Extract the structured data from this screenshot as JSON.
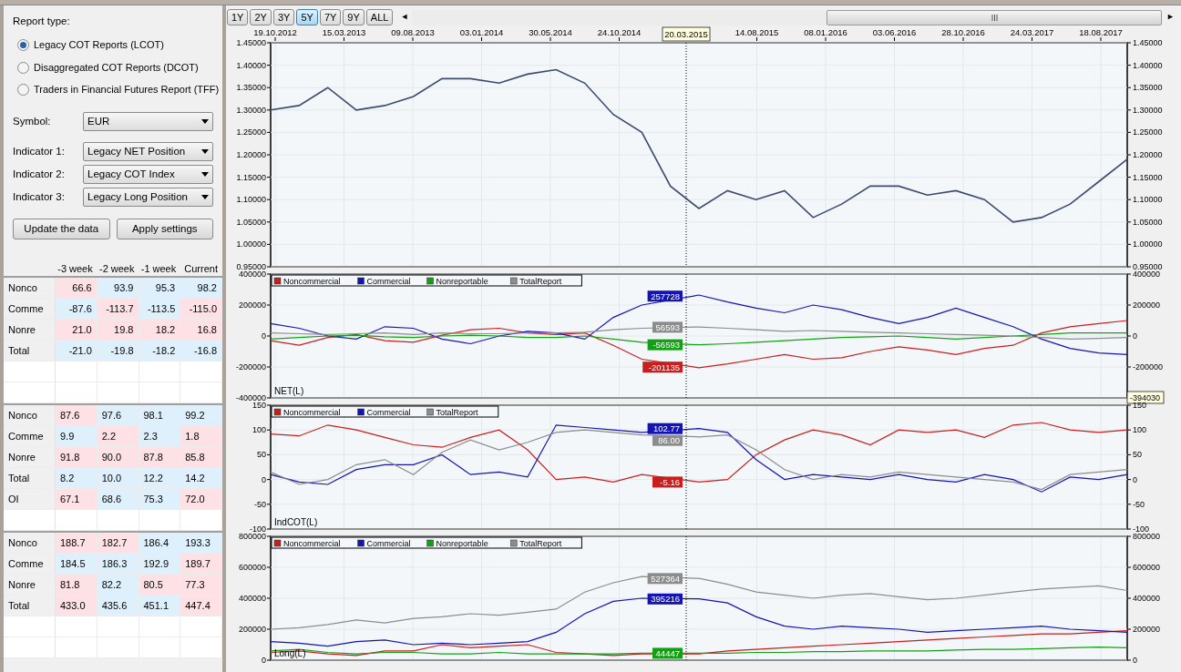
{
  "left_panel": {
    "report_type": {
      "label": "Report type:",
      "options": [
        {
          "label": "Legacy COT Reports (LCOT)",
          "selected": true
        },
        {
          "label": "Disaggregated COT Reports (DCOT)",
          "selected": false
        },
        {
          "label": "Traders in Financial Futures Report (TFF)",
          "selected": false
        }
      ]
    },
    "fields": [
      {
        "label": "Symbol:",
        "value": "EUR"
      },
      {
        "label": "Indicator 1:",
        "value": "Legacy NET Position"
      },
      {
        "label": "Indicator 2:",
        "value": "Legacy COT Index"
      },
      {
        "label": "Indicator 3:",
        "value": "Legacy Long Position"
      }
    ],
    "buttons": [
      "Update the data",
      "Apply settings"
    ],
    "table_header": [
      "-3 week",
      "-2 week",
      "-1 week",
      "Current"
    ],
    "tables": [
      {
        "numbers_right": true,
        "rows": [
          {
            "label": "Nonco",
            "cells": [
              {
                "text": "66.6",
                "color": "#fde1e4"
              },
              {
                "text": "93.9",
                "color": "#def0fb"
              },
              {
                "text": "95.3",
                "color": "#def0fb"
              },
              {
                "text": "98.2",
                "color": "#def0fb"
              }
            ]
          },
          {
            "label": "Comme",
            "cells": [
              {
                "text": "-87.6",
                "color": "#def0fb"
              },
              {
                "text": "-113.7",
                "color": "#fde1e4"
              },
              {
                "text": "-113.5",
                "color": "#def0fb"
              },
              {
                "text": "-115.0",
                "color": "#fde1e4"
              }
            ]
          },
          {
            "label": "Nonre",
            "cells": [
              {
                "text": "21.0",
                "color": "#fde1e4"
              },
              {
                "text": "19.8",
                "color": "#fde1e4"
              },
              {
                "text": "18.2",
                "color": "#fde1e4"
              },
              {
                "text": "16.8",
                "color": "#fde1e4"
              }
            ]
          },
          {
            "label": "Total",
            "cells": [
              {
                "text": "-21.0",
                "color": "#def0fb"
              },
              {
                "text": "-19.8",
                "color": "#def0fb"
              },
              {
                "text": "-18.2",
                "color": "#def0fb"
              },
              {
                "text": "-16.8",
                "color": "#def0fb"
              }
            ]
          }
        ]
      },
      {
        "numbers_right": false,
        "rows": [
          {
            "label": "Nonco",
            "cells": [
              {
                "text": "87.6",
                "color": "#fde1e4"
              },
              {
                "text": "97.6",
                "color": "#def0fb"
              },
              {
                "text": "98.1",
                "color": "#def0fb"
              },
              {
                "text": "99.2",
                "color": "#def0fb"
              }
            ]
          },
          {
            "label": "Comme",
            "cells": [
              {
                "text": "9.9",
                "color": "#def0fb"
              },
              {
                "text": "2.2",
                "color": "#fde1e4"
              },
              {
                "text": "2.3",
                "color": "#def0fb"
              },
              {
                "text": "1.8",
                "color": "#fde1e4"
              }
            ]
          },
          {
            "label": "Nonre",
            "cells": [
              {
                "text": "91.8",
                "color": "#fde1e4"
              },
              {
                "text": "90.0",
                "color": "#fde1e4"
              },
              {
                "text": "87.8",
                "color": "#fde1e4"
              },
              {
                "text": "85.8",
                "color": "#fde1e4"
              }
            ]
          },
          {
            "label": "Total",
            "cells": [
              {
                "text": "8.2",
                "color": "#def0fb"
              },
              {
                "text": "10.0",
                "color": "#def0fb"
              },
              {
                "text": "12.2",
                "color": "#def0fb"
              },
              {
                "text": "14.2",
                "color": "#def0fb"
              }
            ]
          },
          {
            "label": "OI",
            "cells": [
              {
                "text": "67.1",
                "color": "#fde1e4"
              },
              {
                "text": "68.6",
                "color": "#def0fb"
              },
              {
                "text": "75.3",
                "color": "#def0fb"
              },
              {
                "text": "72.0",
                "color": "#fde1e4"
              }
            ]
          }
        ]
      },
      {
        "numbers_right": false,
        "rows": [
          {
            "label": "Nonco",
            "cells": [
              {
                "text": "188.7",
                "color": "#fde1e4"
              },
              {
                "text": "182.7",
                "color": "#fde1e4"
              },
              {
                "text": "186.4",
                "color": "#def0fb"
              },
              {
                "text": "193.3",
                "color": "#def0fb"
              }
            ]
          },
          {
            "label": "Comme",
            "cells": [
              {
                "text": "184.5",
                "color": "#def0fb"
              },
              {
                "text": "186.3",
                "color": "#def0fb"
              },
              {
                "text": "192.9",
                "color": "#def0fb"
              },
              {
                "text": "189.7",
                "color": "#fde1e4"
              }
            ]
          },
          {
            "label": "Nonre",
            "cells": [
              {
                "text": "81.8",
                "color": "#fde1e4"
              },
              {
                "text": "82.2",
                "color": "#def0fb"
              },
              {
                "text": "80.5",
                "color": "#fde1e4"
              },
              {
                "text": "77.3",
                "color": "#fde1e4"
              }
            ]
          },
          {
            "label": "Total",
            "cells": [
              {
                "text": "433.0",
                "color": "#fde1e4"
              },
              {
                "text": "435.6",
                "color": "#def0fb"
              },
              {
                "text": "451.1",
                "color": "#def0fb"
              },
              {
                "text": "447.4",
                "color": "#fde1e4"
              }
            ]
          }
        ]
      }
    ]
  },
  "range_buttons": [
    {
      "label": "1Y",
      "selected": false
    },
    {
      "label": "2Y",
      "selected": false
    },
    {
      "label": "3Y",
      "selected": false
    },
    {
      "label": "5Y",
      "selected": true
    },
    {
      "label": "7Y",
      "selected": false
    },
    {
      "label": "9Y",
      "selected": false
    },
    {
      "label": "ALL",
      "selected": false
    }
  ],
  "scroll_left": "◄",
  "scroll_right": "►",
  "date_axis": {
    "ticks": [
      "19.10.2012",
      "15.03.2013",
      "09.08.2013",
      "03.01.2014",
      "30.05.2014",
      "24.10.2014",
      "14.08.2015",
      "08.01.2016",
      "03.06.2016",
      "28.10.2016",
      "24.03.2017",
      "18.08.2017"
    ],
    "cursor_label": "20.03.2015"
  },
  "charts": [
    {
      "chart_data": {
        "type": "line",
        "grid": true,
        "ylim": [
          0.95,
          1.45
        ],
        "yticks": [
          {
            "value": 0.95,
            "label": "0.95000"
          },
          {
            "value": 1.0,
            "label": "1.00000"
          },
          {
            "value": 1.05,
            "label": "1.05000"
          },
          {
            "value": 1.1,
            "label": "1.10000"
          },
          {
            "value": 1.15,
            "label": "1.15000"
          },
          {
            "value": 1.2,
            "label": "1.20000"
          },
          {
            "value": 1.25,
            "label": "1.25000"
          },
          {
            "value": 1.3,
            "label": "1.30000"
          },
          {
            "value": 1.35,
            "label": "1.35000"
          },
          {
            "value": 1.4,
            "label": "1.40000"
          },
          {
            "value": 1.45,
            "label": "1.45000"
          }
        ],
        "values": [
          1.3,
          1.31,
          1.35,
          1.3,
          1.31,
          1.33,
          1.37,
          1.37,
          1.36,
          1.38,
          1.39,
          1.36,
          1.29,
          1.25,
          1.13,
          1.08,
          1.12,
          1.1,
          1.12,
          1.06,
          1.09,
          1.13,
          1.13,
          1.11,
          1.12,
          1.1,
          1.05,
          1.06,
          1.09,
          1.14,
          1.19
        ]
      }
    },
    {
      "title": "NET(L)",
      "cursor_value": "-394030",
      "chart_data": {
        "type": "line",
        "grid": true,
        "legend": "upper left",
        "ylim": [
          -400000,
          400000
        ],
        "yticks": [
          {
            "value": -400000,
            "label": "-400000"
          },
          {
            "value": -200000,
            "label": "-200000"
          },
          {
            "value": 0,
            "label": "0"
          },
          {
            "value": 200000,
            "label": "200000"
          },
          {
            "value": 400000,
            "label": "400000"
          }
        ],
        "series": [
          {
            "name": "Noncommercial",
            "color": "#c81e1e",
            "values": [
              -30000,
              -60000,
              -10000,
              10000,
              -30000,
              -40000,
              5000,
              40000,
              50000,
              20000,
              10000,
              20000,
              -60000,
              -150000,
              null,
              -205000,
              -180000,
              -150000,
              -120000,
              -150000,
              -140000,
              -100000,
              -70000,
              -90000,
              -120000,
              -80000,
              -60000,
              20000,
              60000,
              80000,
              100000
            ]
          },
          {
            "name": "Commercial",
            "color": "#1414b4",
            "values": [
              80000,
              50000,
              0,
              -20000,
              60000,
              50000,
              -20000,
              -50000,
              0,
              30000,
              20000,
              -20000,
              120000,
              200000,
              null,
              265000,
              220000,
              180000,
              150000,
              200000,
              170000,
              120000,
              80000,
              120000,
              180000,
              120000,
              60000,
              -20000,
              -80000,
              -110000,
              -120000
            ]
          },
          {
            "name": "Nonreportable",
            "color": "#14a014",
            "values": [
              -20000,
              -10000,
              0,
              5000,
              -5000,
              -10000,
              0,
              5000,
              0,
              -10000,
              -10000,
              0,
              -20000,
              -40000,
              null,
              -57000,
              -50000,
              -40000,
              -30000,
              -20000,
              -10000,
              -5000,
              0,
              -10000,
              -20000,
              -10000,
              0,
              10000,
              20000,
              20000,
              20000
            ]
          },
          {
            "name": "TotalReport",
            "color": "#8c8c8c",
            "values": [
              20000,
              15000,
              10000,
              15000,
              20000,
              10000,
              20000,
              15000,
              15000,
              20000,
              20000,
              25000,
              40000,
              50000,
              null,
              58000,
              50000,
              40000,
              30000,
              35000,
              30000,
              25000,
              20000,
              15000,
              10000,
              5000,
              0,
              -10000,
              -20000,
              -15000,
              -10000
            ]
          }
        ]
      },
      "cursor_tags": [
        {
          "text": "257728",
          "color": "#1414b4"
        },
        {
          "text": "56593",
          "color": "#8c8c8c"
        },
        {
          "text": "-56593",
          "color": "#14a014"
        },
        {
          "text": "-201135",
          "color": "#c81e1e"
        }
      ]
    },
    {
      "title": "IndCOT(L)",
      "chart_data": {
        "type": "line",
        "grid": true,
        "legend": "upper left",
        "ylim": [
          -100,
          150
        ],
        "yticks": [
          {
            "value": -100,
            "label": "-100"
          },
          {
            "value": -50,
            "label": "-50"
          },
          {
            "value": 0,
            "label": "0"
          },
          {
            "value": 50,
            "label": "50"
          },
          {
            "value": 100,
            "label": "100"
          },
          {
            "value": 150,
            "label": "150"
          }
        ],
        "series": [
          {
            "name": "Noncommercial",
            "color": "#c81e1e",
            "values": [
              92,
              88,
              110,
              100,
              85,
              70,
              65,
              85,
              100,
              60,
              0,
              5,
              -5,
              10,
              null,
              -5,
              0,
              50,
              80,
              100,
              90,
              70,
              100,
              95,
              100,
              85,
              110,
              115,
              100,
              95,
              100
            ]
          },
          {
            "name": "Commercial",
            "color": "#1414b4",
            "values": [
              10,
              -5,
              -10,
              20,
              30,
              30,
              50,
              10,
              15,
              5,
              110,
              105,
              100,
              95,
              null,
              103,
              95,
              40,
              0,
              10,
              5,
              0,
              10,
              0,
              -5,
              10,
              0,
              -25,
              5,
              0,
              10
            ]
          },
          {
            "name": "TotalReport",
            "color": "#8c8c8c",
            "values": [
              15,
              -10,
              0,
              30,
              40,
              10,
              55,
              80,
              60,
              75,
              95,
              100,
              95,
              90,
              null,
              86,
              90,
              60,
              20,
              0,
              10,
              5,
              15,
              10,
              5,
              0,
              -5,
              -20,
              10,
              15,
              20
            ]
          }
        ]
      },
      "cursor_tags": [
        {
          "text": "102.77",
          "color": "#1414b4"
        },
        {
          "text": "86.00",
          "color": "#8c8c8c"
        },
        {
          "text": "-5.16",
          "color": "#c81e1e"
        }
      ]
    },
    {
      "title": "Long(L)",
      "chart_data": {
        "type": "line",
        "grid": true,
        "legend": "upper left",
        "ylim": [
          0,
          800000
        ],
        "yticks": [
          {
            "value": 0,
            "label": "0"
          },
          {
            "value": 200000,
            "label": "200000"
          },
          {
            "value": 400000,
            "label": "400000"
          },
          {
            "value": 600000,
            "label": "600000"
          },
          {
            "value": 800000,
            "label": "800000"
          }
        ],
        "series": [
          {
            "name": "Noncommercial",
            "color": "#c81e1e",
            "values": [
              50000,
              60000,
              40000,
              30000,
              60000,
              60000,
              100000,
              80000,
              90000,
              100000,
              50000,
              40000,
              30000,
              40000,
              null,
              40000,
              60000,
              70000,
              80000,
              90000,
              100000,
              110000,
              120000,
              130000,
              140000,
              150000,
              160000,
              170000,
              170000,
              180000,
              190000
            ]
          },
          {
            "name": "Commercial",
            "color": "#1414b4",
            "values": [
              120000,
              110000,
              90000,
              120000,
              130000,
              100000,
              110000,
              100000,
              110000,
              120000,
              180000,
              300000,
              380000,
              400000,
              null,
              396000,
              370000,
              280000,
              220000,
              200000,
              220000,
              210000,
              200000,
              180000,
              190000,
              200000,
              210000,
              220000,
              200000,
              190000,
              180000
            ]
          },
          {
            "name": "Nonreportable",
            "color": "#14a014",
            "values": [
              60000,
              70000,
              50000,
              40000,
              50000,
              50000,
              40000,
              40000,
              50000,
              40000,
              40000,
              40000,
              40000,
              45000,
              null,
              45000,
              45000,
              50000,
              50000,
              55000,
              55000,
              60000,
              60000,
              60000,
              65000,
              70000,
              70000,
              75000,
              80000,
              85000,
              80000
            ]
          },
          {
            "name": "TotalReport",
            "color": "#8c8c8c",
            "values": [
              200000,
              210000,
              230000,
              260000,
              240000,
              270000,
              280000,
              300000,
              290000,
              310000,
              330000,
              440000,
              500000,
              540000,
              null,
              528000,
              490000,
              440000,
              420000,
              400000,
              420000,
              430000,
              410000,
              390000,
              400000,
              420000,
              440000,
              460000,
              470000,
              480000,
              450000
            ]
          }
        ]
      },
      "cursor_tags": [
        {
          "text": "527364",
          "color": "#8c8c8c"
        },
        {
          "text": "395216",
          "color": "#1414b4"
        },
        {
          "text": "44447",
          "color": "#14a014"
        }
      ]
    }
  ]
}
